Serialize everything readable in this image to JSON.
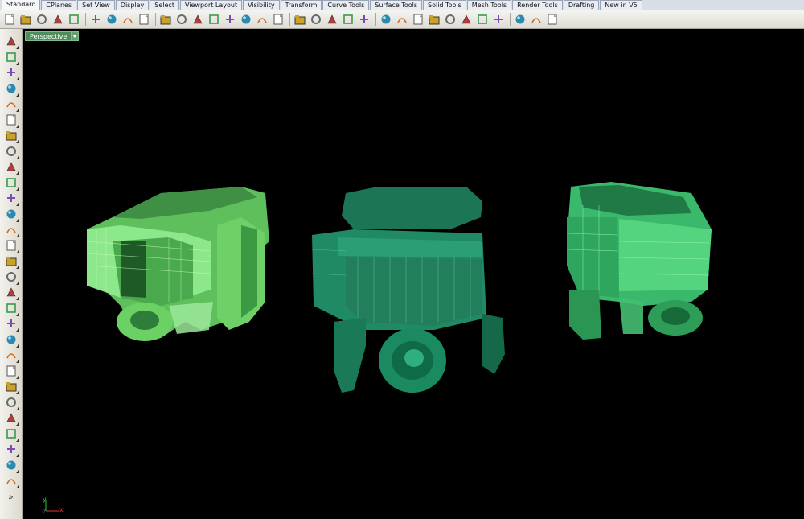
{
  "tabs": [
    {
      "label": "Standard",
      "active": true
    },
    {
      "label": "CPlanes"
    },
    {
      "label": "Set View"
    },
    {
      "label": "Display"
    },
    {
      "label": "Select"
    },
    {
      "label": "Viewport Layout"
    },
    {
      "label": "Visibility"
    },
    {
      "label": "Transform"
    },
    {
      "label": "Curve Tools"
    },
    {
      "label": "Surface Tools"
    },
    {
      "label": "Solid Tools"
    },
    {
      "label": "Mesh Tools"
    },
    {
      "label": "Render Tools"
    },
    {
      "label": "Drafting"
    },
    {
      "label": "New in V5"
    }
  ],
  "toolbar_icons": [
    "new-icon",
    "open-icon",
    "save-icon",
    "print-icon",
    "import-icon",
    "cut-icon",
    "copy-icon",
    "paste-icon",
    "undo-icon",
    "pan-icon",
    "move-icon",
    "zoom-icon",
    "zoom-window-icon",
    "zoom-extents-icon",
    "zoom-selected-icon",
    "rotate-view-icon",
    "zoom-target-icon",
    "four-views-icon",
    "cplane-icon",
    "grid-icon",
    "select-window-icon",
    "lock-icon",
    "hide-icon",
    "light-icon",
    "layer-lock-icon",
    "material-icon",
    "color-wheel-icon",
    "shade-icon",
    "render-icon",
    "sphere-render-icon",
    "properties-icon",
    "options-icon",
    "help-icon"
  ],
  "left_toolbar_icons": [
    "select-arrow-icon",
    "point-icon",
    "polyline-icon",
    "curve-icon",
    "circle-icon",
    "ellipse-icon",
    "arc-icon",
    "rectangle-icon",
    "polygon-icon",
    "fillet-icon",
    "offset-icon",
    "extend-icon",
    "box-icon",
    "sphere-icon",
    "cylinder-icon",
    "plane-surface-icon",
    "extrude-icon",
    "boolean-icon",
    "move-gumball-icon",
    "mesh-icon",
    "cap-icon",
    "blend-icon",
    "trim-icon",
    "join-icon",
    "explode-icon",
    "group-icon",
    "array-icon",
    "text-icon",
    "block-icon"
  ],
  "viewport": {
    "title": "Perspective"
  },
  "axis": {
    "x_label": "x",
    "y_label": "y",
    "z_label": "z"
  },
  "colors": {
    "accent_tab": "#4d8e5c",
    "model_left": "#7fe07a",
    "model_mid": "#1f8a66",
    "model_right": "#39c06c"
  },
  "more_label": "»"
}
